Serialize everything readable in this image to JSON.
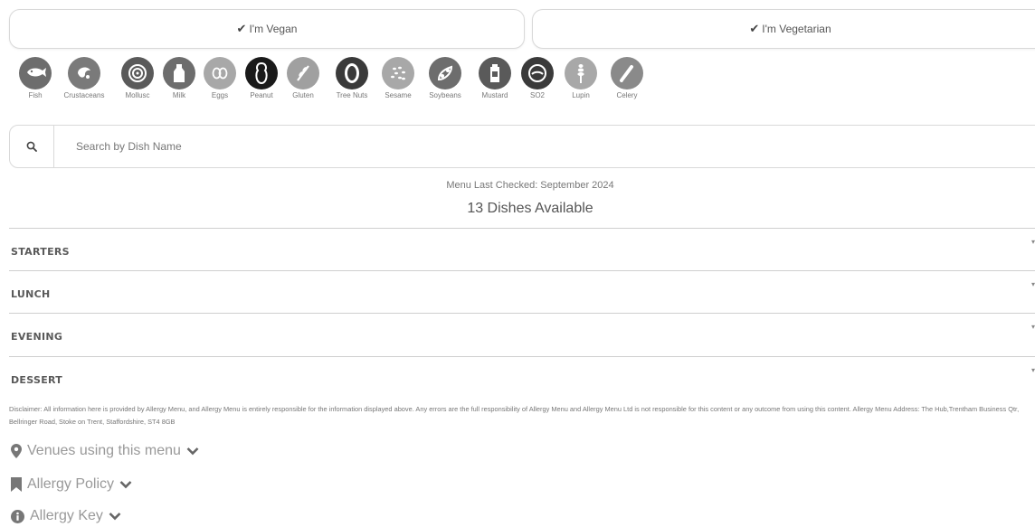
{
  "diet_buttons": {
    "vegan": "I'm Vegan",
    "vegetarian": "I'm Vegetarian"
  },
  "allergens": [
    {
      "label": "Fish",
      "icon": "fish-icon",
      "color": "#6d6d6d"
    },
    {
      "label": "Crustaceans",
      "icon": "crustacean-icon",
      "color": "#7a7a7a"
    },
    {
      "label": "Mollusc",
      "icon": "mollusc-icon",
      "color": "#5a5a5a"
    },
    {
      "label": "Milk",
      "icon": "milk-icon",
      "color": "#6d6d6d"
    },
    {
      "label": "Eggs",
      "icon": "eggs-icon",
      "color": "#a8a8a8"
    },
    {
      "label": "Peanut",
      "icon": "peanut-icon",
      "color": "#1a1a1a"
    },
    {
      "label": "Gluten",
      "icon": "gluten-icon",
      "color": "#a0a0a0"
    },
    {
      "label": "Tree Nuts",
      "icon": "tree-nuts-icon",
      "color": "#3a3a3a"
    },
    {
      "label": "Sesame",
      "icon": "sesame-icon",
      "color": "#a8a8a8"
    },
    {
      "label": "Soybeans",
      "icon": "soybeans-icon",
      "color": "#6d6d6d"
    },
    {
      "label": "Mustard",
      "icon": "mustard-icon",
      "color": "#5a5a5a"
    },
    {
      "label": "SO2",
      "icon": "so2-icon",
      "color": "#3a3a3a"
    },
    {
      "label": "Lupin",
      "icon": "lupin-icon",
      "color": "#a8a8a8"
    },
    {
      "label": "Celery",
      "icon": "celery-icon",
      "color": "#8a8a8a"
    }
  ],
  "search": {
    "placeholder": "Search by Dish Name"
  },
  "menu_checked": "Menu Last Checked: September 2024",
  "dishes_available": "13 Dishes Available",
  "sections": {
    "starters": "Starters",
    "lunch": "Lunch",
    "evening": "Evening",
    "dessert": "Dessert"
  },
  "disclaimer": "Disclaimer: All information here is provided by Allergy Menu, and Allergy Menu is entirely responsible for the information displayed above. Any errors are the full responsibility of Allergy Menu and Allergy Menu Ltd is not responsible for this content or any outcome from using this content. Allergy Menu Address: The Hub,Trentham Business Qtr, Bellringer Road, Stoke on Trent, Staffordshire, ST4 8GB",
  "expanders": {
    "venues": "Venues using this menu",
    "policy": "Allergy Policy",
    "key": "Allergy Key"
  }
}
